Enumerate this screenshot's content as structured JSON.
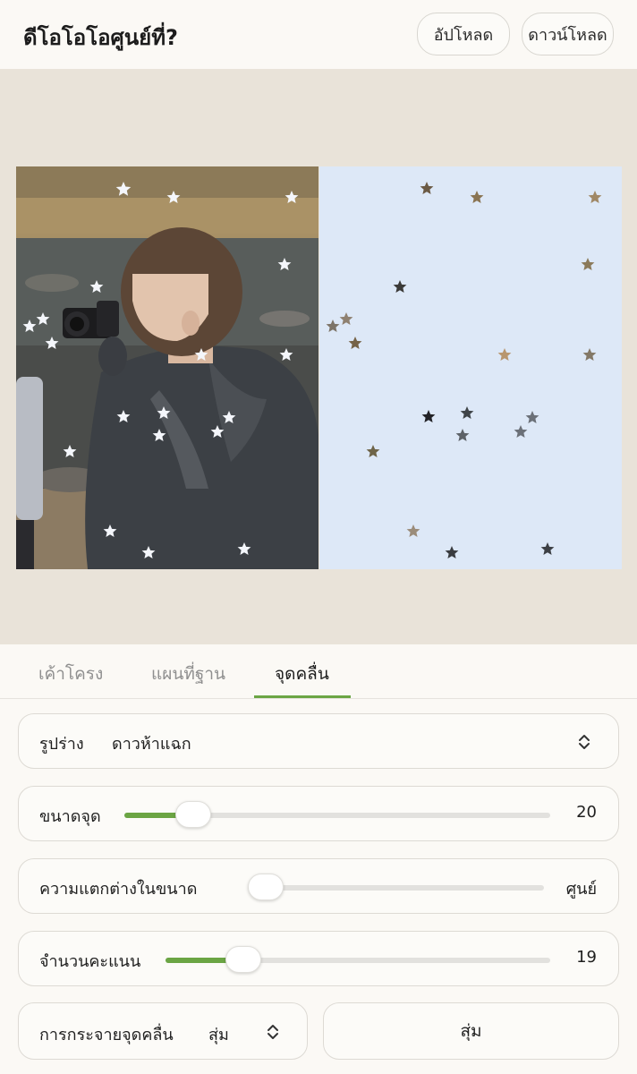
{
  "header": {
    "title": "ดีโอโอโอศูนย์ที่?",
    "upload_label": "อัปโหลด",
    "download_label": "ดาวน์โหลด"
  },
  "preview": {
    "left_image": "portrait-photo-with-camera",
    "right_pattern_background": "#dde8f7",
    "shape_icon": "star-icon"
  },
  "tabs": {
    "items": [
      {
        "label": "เค้าโครง"
      },
      {
        "label": "แผนที่ฐาน"
      },
      {
        "label": "จุดคลื่น"
      }
    ],
    "active_index": 2,
    "accent": "#6ba544"
  },
  "controls": {
    "shape": {
      "label": "รูปร่าง",
      "value": "ดาวห้าแฉก"
    },
    "dot_size": {
      "label": "ขนาดจุด",
      "value": "20",
      "fraction": 0.16
    },
    "size_variation": {
      "label": "ความแตกต่างในขนาด",
      "value": "ศูนย์",
      "fraction": 0.0
    },
    "count": {
      "label": "จำนวนคะแนน",
      "value": "19",
      "fraction": 0.2
    },
    "distribution": {
      "label": "การกระจายจุดคลื่น",
      "value": "สุ่ม"
    },
    "random_button": "สุ่ม"
  }
}
